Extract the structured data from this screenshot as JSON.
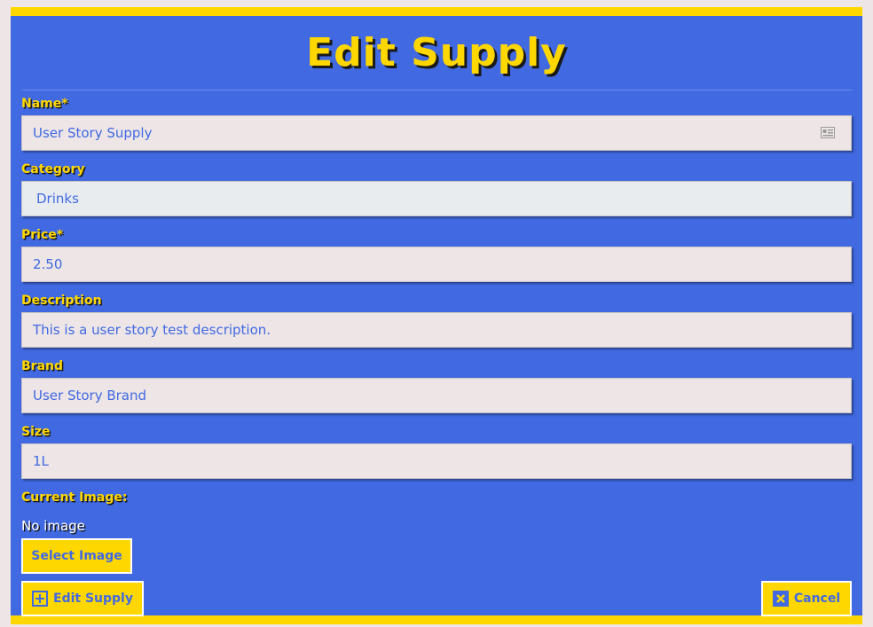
{
  "page": {
    "title": "Edit Supply"
  },
  "form": {
    "name": {
      "label": "Name*",
      "value": "User Story Supply",
      "icon": "contact-card-icon"
    },
    "category": {
      "label": "Category",
      "value": "Drinks"
    },
    "price": {
      "label": "Price*",
      "value": "2.50"
    },
    "description": {
      "label": "Description",
      "value": "This is a user story test description."
    },
    "brand": {
      "label": "Brand",
      "value": "User Story Brand"
    },
    "size": {
      "label": "Size",
      "value": "1L"
    },
    "image": {
      "label": "Current Image:",
      "status": "No image",
      "select_label": "Select Image"
    }
  },
  "actions": {
    "submit_label": "Edit Supply",
    "submit_icon": "plus-square-icon",
    "cancel_label": "Cancel",
    "cancel_icon": "x-square-icon"
  },
  "colors": {
    "panel": "#4169e1",
    "accent": "#ffd700",
    "field_bg": "#ede5e6",
    "text": "#4169e1"
  }
}
